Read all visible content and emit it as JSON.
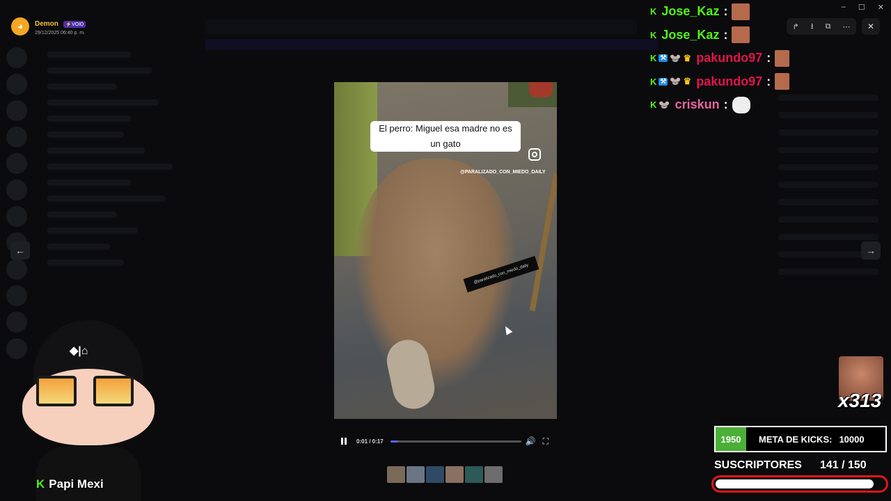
{
  "notification": {
    "username": "Demon",
    "badge": "⚡VOID",
    "timestamp": "29/12/2025 06:40 p. m."
  },
  "window_controls": [
    "–",
    "☐",
    "✕"
  ],
  "viewer_toolbar": {
    "icons": [
      "forward-icon",
      "download-icon",
      "open-external-icon",
      "more-icon"
    ],
    "glyphs": [
      "↱",
      "⭳",
      "⧉",
      "⋯"
    ],
    "close_glyph": "✕"
  },
  "nav": {
    "prev_glyph": "←",
    "next_glyph": "→"
  },
  "video": {
    "caption": "El perro: Miguel esa madre no es un gato",
    "handle": "@PARALIZADO_CON_MIEDO_DAILY",
    "sticker": "@paralizado_con_miedo_daily",
    "time": "0:01 / 0:17",
    "progress": 0.06,
    "volume_glyph": "🔊",
    "fullscreen_glyph": "⛶"
  },
  "thumbnails": [
    "#7a6a58",
    "#6a7585",
    "#2e4a66",
    "#8a7060",
    "#2c5a58",
    "#6d6d6d"
  ],
  "chat": [
    {
      "badges": [
        "K"
      ],
      "username": "Jose_Kaz",
      "color": "#52f318",
      "emote": "face"
    },
    {
      "badges": [
        "K"
      ],
      "username": "Jose_Kaz",
      "color": "#52f318",
      "emote": "face"
    },
    {
      "badges": [
        "K",
        "mod",
        "cheese",
        "crown"
      ],
      "username": "pakundo97",
      "color": "#e0154b",
      "emote": "face"
    },
    {
      "badges": [
        "K",
        "mod",
        "cheese",
        "crown"
      ],
      "username": "pakundo97",
      "color": "#e0154b",
      "emote": "face"
    },
    {
      "badges": [
        "K",
        "cheese"
      ],
      "username": "criskun",
      "color": "#e8669e",
      "emote": "dog"
    }
  ],
  "combo": {
    "text": "x313"
  },
  "kicks": {
    "count": "1950",
    "label": "META DE KICKS:",
    "goal": "10000"
  },
  "subs": {
    "label": "SUSCRIPTORES",
    "count": "141 / 150",
    "progress": 0.94
  },
  "avatar": {
    "name": "Papi Mexi",
    "k": "K",
    "logo": "◆|⌂"
  },
  "colors": {
    "kick_green": "#52f318",
    "accent": "#5865f2",
    "subs_red": "#e01616"
  }
}
